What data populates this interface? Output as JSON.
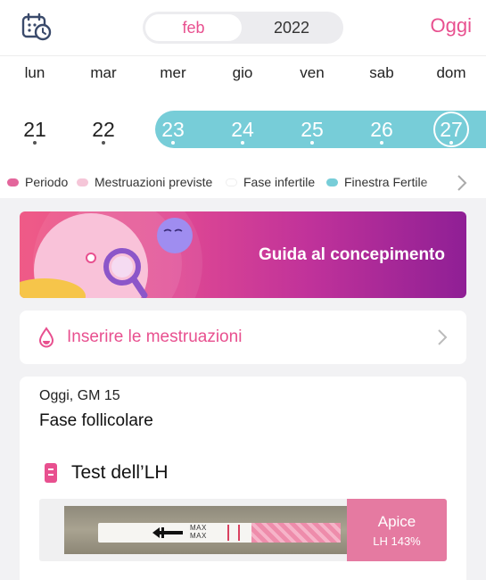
{
  "header": {
    "calendar_icon": "calendar-clock-icon",
    "month_label": "feb",
    "year_label": "2022",
    "today_label": "Oggi"
  },
  "weekdays": [
    "lun",
    "mar",
    "mer",
    "gio",
    "ven",
    "sab",
    "dom"
  ],
  "days": [
    "21",
    "22",
    "23",
    "24",
    "25",
    "26",
    "27"
  ],
  "legend": {
    "items": [
      {
        "label": "Periodo",
        "color": "#e3669c"
      },
      {
        "label": "Mestruazioni previste",
        "color": "#f5c6d8"
      },
      {
        "label": "Fase infertile",
        "color": "#ffffff"
      },
      {
        "label": "Finestra Fertile",
        "color": "#77cdd8"
      }
    ]
  },
  "banner": {
    "title": "Guida al concepimento"
  },
  "period_card": {
    "label": "Inserire le mestruazioni"
  },
  "status_card": {
    "subtitle": "Oggi, GM 15",
    "phase": "Fase follicolare",
    "lh_title": "Test dell’LH",
    "strip_text": "MAX\nMAX",
    "apex_title": "Apice",
    "apex_value": "LH 143%"
  },
  "colors": {
    "accent": "#e8508f",
    "fertile": "#77cdd8"
  }
}
